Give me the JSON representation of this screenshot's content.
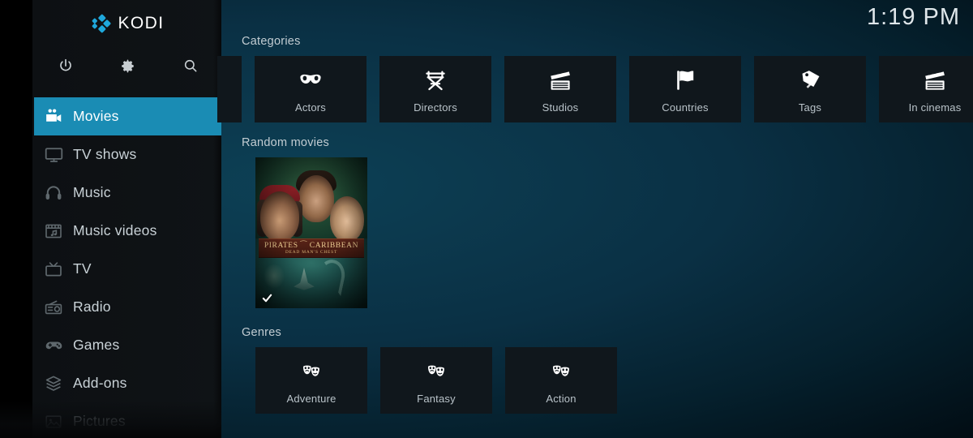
{
  "app": {
    "logo_text": "KODI",
    "logo_tm": "™",
    "logo_icon": "kodi-logo-icon",
    "accent_color": "#1a8cb4",
    "logo_color": "#1fa8dc",
    "background_color": "#0a3044",
    "tile_color": "#10171c"
  },
  "clock": {
    "time": "1:19 PM"
  },
  "sidebar": {
    "quick_actions": [
      {
        "name": "power-icon",
        "label": "Power"
      },
      {
        "name": "settings-icon",
        "label": "Settings"
      },
      {
        "name": "search-icon",
        "label": "Search"
      }
    ],
    "items": [
      {
        "label": "Movies",
        "icon": "movie-camera-icon",
        "selected": true
      },
      {
        "label": "TV shows",
        "icon": "television-icon",
        "selected": false
      },
      {
        "label": "Music",
        "icon": "headphones-icon",
        "selected": false
      },
      {
        "label": "Music videos",
        "icon": "music-video-icon",
        "selected": false
      },
      {
        "label": "TV",
        "icon": "retro-tv-icon",
        "selected": false
      },
      {
        "label": "Radio",
        "icon": "radio-icon",
        "selected": false
      },
      {
        "label": "Games",
        "icon": "gamepad-icon",
        "selected": false
      },
      {
        "label": "Add-ons",
        "icon": "addon-box-icon",
        "selected": false
      },
      {
        "label": "Pictures",
        "icon": "picture-icon",
        "selected": false
      }
    ]
  },
  "main": {
    "sections": [
      {
        "title": "Categories"
      },
      {
        "title": "Random movies"
      },
      {
        "title": "Genres"
      }
    ],
    "categories": [
      {
        "label": "Actors",
        "icon": "mask-icon"
      },
      {
        "label": "Directors",
        "icon": "director-chair-icon"
      },
      {
        "label": "Studios",
        "icon": "clapperboard-icon"
      },
      {
        "label": "Countries",
        "icon": "flag-icon"
      },
      {
        "label": "Tags",
        "icon": "tag-icon"
      },
      {
        "label": "In cinemas",
        "icon": "clapperboard-icon"
      }
    ],
    "random_movies": [
      {
        "title": "Pirates of the Caribbean: Dead Man's Chest",
        "poster_title_line1": "PIRATES ⁀ CARIBBEAN",
        "poster_title_line2": "DEAD MAN'S CHEST",
        "watched": true,
        "watched_icon": "check-icon"
      }
    ],
    "genres": [
      {
        "label": "Adventure",
        "icon": "theatre-masks-icon"
      },
      {
        "label": "Fantasy",
        "icon": "theatre-masks-icon"
      },
      {
        "label": "Action",
        "icon": "theatre-masks-icon"
      }
    ]
  }
}
